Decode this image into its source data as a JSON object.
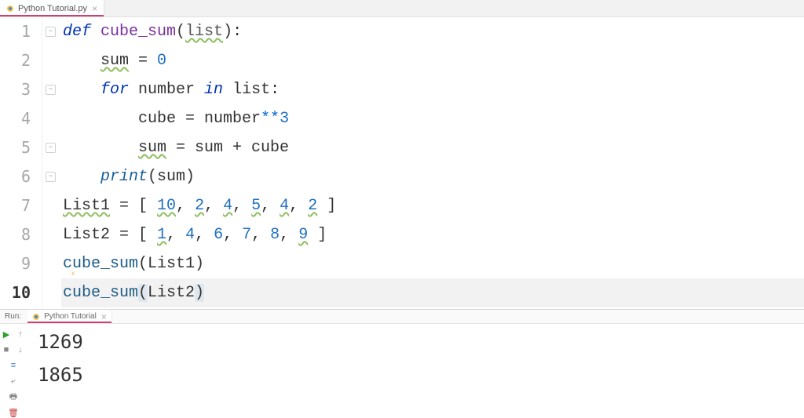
{
  "editor": {
    "tab": {
      "filename": "Python Tutorial.py"
    },
    "gutter": [
      "1",
      "2",
      "3",
      "4",
      "5",
      "6",
      "7",
      "8",
      "9",
      "10"
    ],
    "current_line_index": 9,
    "fold_regions": [
      0,
      2,
      4,
      5
    ],
    "code_tokens": [
      [
        {
          "t": "def ",
          "c": "kw"
        },
        {
          "t": "cube_sum",
          "c": "fn"
        },
        {
          "t": "(",
          "c": "op"
        },
        {
          "t": "list",
          "c": "param warn"
        },
        {
          "t": "):",
          "c": "op"
        }
      ],
      [
        {
          "t": "    ",
          "c": ""
        },
        {
          "t": "sum",
          "c": "var warn"
        },
        {
          "t": " = ",
          "c": "op"
        },
        {
          "t": "0",
          "c": "num"
        }
      ],
      [
        {
          "t": "    ",
          "c": ""
        },
        {
          "t": "for ",
          "c": "kw"
        },
        {
          "t": "number ",
          "c": "var"
        },
        {
          "t": "in ",
          "c": "kw"
        },
        {
          "t": "list:",
          "c": "var"
        }
      ],
      [
        {
          "t": "        cube = number",
          "c": "var"
        },
        {
          "t": "**",
          "c": "star"
        },
        {
          "t": "3",
          "c": "num"
        }
      ],
      [
        {
          "t": "        ",
          "c": ""
        },
        {
          "t": "sum",
          "c": "var warn"
        },
        {
          "t": " = sum + cube",
          "c": "var"
        }
      ],
      [
        {
          "t": "    ",
          "c": ""
        },
        {
          "t": "print",
          "c": "builtin"
        },
        {
          "t": "(sum)",
          "c": "var"
        }
      ],
      [
        {
          "t": "List1",
          "c": "var warn"
        },
        {
          "t": " = [ ",
          "c": "op"
        },
        {
          "t": "10",
          "c": "num warn"
        },
        {
          "t": ", ",
          "c": "op"
        },
        {
          "t": "2",
          "c": "num warn"
        },
        {
          "t": ", ",
          "c": "op"
        },
        {
          "t": "4",
          "c": "num warn"
        },
        {
          "t": ", ",
          "c": "op"
        },
        {
          "t": "5",
          "c": "num warn"
        },
        {
          "t": ", ",
          "c": "op"
        },
        {
          "t": "4",
          "c": "num warn"
        },
        {
          "t": ", ",
          "c": "op"
        },
        {
          "t": "2",
          "c": "num warn"
        },
        {
          "t": " ]",
          "c": "op"
        }
      ],
      [
        {
          "t": "List2 = [ ",
          "c": "var"
        },
        {
          "t": "1",
          "c": "num warn"
        },
        {
          "t": ", ",
          "c": "op"
        },
        {
          "t": "4",
          "c": "num"
        },
        {
          "t": ", ",
          "c": "op"
        },
        {
          "t": "6",
          "c": "num"
        },
        {
          "t": ", ",
          "c": "op"
        },
        {
          "t": "7",
          "c": "num"
        },
        {
          "t": ", ",
          "c": "op"
        },
        {
          "t": "8",
          "c": "num"
        },
        {
          "t": ", ",
          "c": "op"
        },
        {
          "t": "9",
          "c": "num warn"
        },
        {
          "t": " ]",
          "c": "op"
        }
      ],
      [
        {
          "t": "cube_sum",
          "c": "call"
        },
        {
          "t": "(List1)",
          "c": "var"
        }
      ],
      [
        {
          "t": "cube_sum",
          "c": "call"
        },
        {
          "t": "(",
          "c": "op cursor-bracket"
        },
        {
          "t": "List2",
          "c": "var"
        },
        {
          "t": ")",
          "c": "op cursor-bracket"
        }
      ]
    ]
  },
  "run": {
    "label": "Run:",
    "tab_name": "Python Tutorial",
    "output": [
      "1269",
      "1865"
    ]
  },
  "toolbar_icons": {
    "rerun": "▶",
    "up": "↑",
    "stop": "■",
    "down": "↓",
    "layout": "≡",
    "wrap": "⤶",
    "print": "🖶",
    "trash": "🗑"
  }
}
